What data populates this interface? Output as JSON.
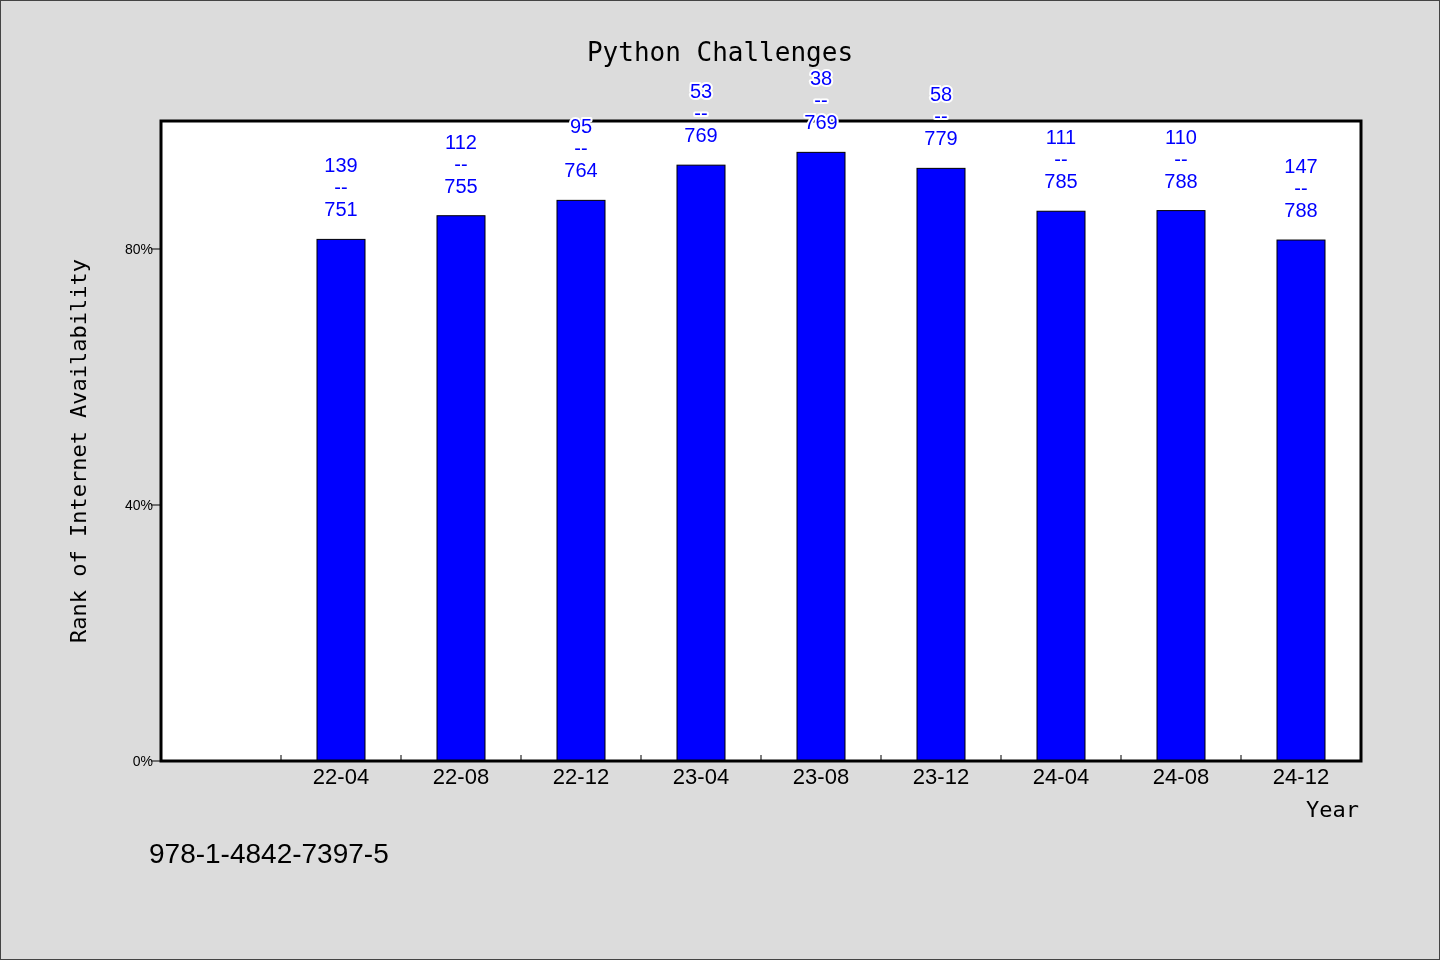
{
  "chart_data": {
    "type": "bar",
    "title": "Python Challenges",
    "xlabel": "Year",
    "ylabel": "Rank of Internet Availability",
    "categories": [
      "22-04",
      "22-08",
      "22-12",
      "23-04",
      "23-08",
      "23-12",
      "24-04",
      "24-08",
      "24-12"
    ],
    "values": [
      0.815,
      0.852,
      0.876,
      0.931,
      0.951,
      0.926,
      0.859,
      0.86,
      0.814
    ],
    "ylim": [
      0,
      1
    ],
    "yticks": [
      {
        "value": 0,
        "label": "0%"
      },
      {
        "value": 0.4,
        "label": "40%"
      },
      {
        "value": 0.8,
        "label": "80%"
      }
    ],
    "annotations": [
      "139\n--\n751",
      "112\n--\n755",
      "95\n--\n764",
      "53\n--\n769",
      "38\n--\n769",
      "58\n--\n779",
      "111\n--\n785",
      "110\n--\n788",
      "147\n--\n788"
    ]
  },
  "footer": "978-1-4842-7397-5"
}
